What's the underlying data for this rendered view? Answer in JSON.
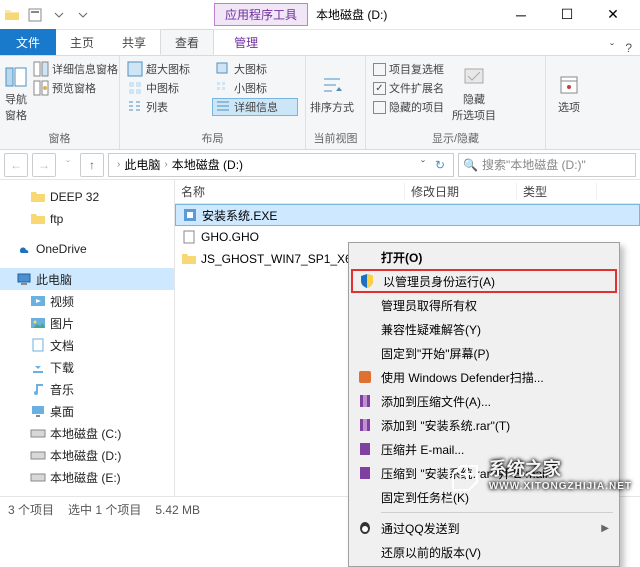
{
  "title": {
    "app_tools": "应用程序工具",
    "location": "本地磁盘 (D:)"
  },
  "tabs": {
    "file": "文件",
    "home": "主页",
    "share": "共享",
    "view": "查看",
    "manage": "管理"
  },
  "ribbon": {
    "pane_group": {
      "nav_pane": "导航窗格",
      "details_pane": "详细信息窗格",
      "preview_pane": "预览窗格",
      "label": "窗格"
    },
    "layout_group": {
      "xl_icons": "超大图标",
      "l_icons": "大图标",
      "m_icons": "中图标",
      "s_icons": "小图标",
      "list": "列表",
      "details": "详细信息",
      "label": "布局"
    },
    "sort_group": {
      "sort": "排序方式",
      "label": "当前视图"
    },
    "show_group": {
      "checkboxes": "项目复选框",
      "ext": "文件扩展名",
      "hidden": "隐藏的项目",
      "hide": "隐藏\n所选项目",
      "label": "显示/隐藏"
    },
    "options": "选项"
  },
  "address": {
    "this_pc": "此电脑",
    "drive": "本地磁盘 (D:)",
    "search_placeholder": "搜索\"本地磁盘 (D:)\""
  },
  "tree": {
    "deep32": "DEEP 32",
    "ftp": "ftp",
    "onedrive": "OneDrive",
    "this_pc": "此电脑",
    "videos": "视频",
    "pictures": "图片",
    "documents": "文档",
    "downloads": "下载",
    "music": "音乐",
    "desktop": "桌面",
    "drive_c": "本地磁盘 (C:)",
    "drive_d": "本地磁盘 (D:)",
    "drive_e": "本地磁盘 (E:)"
  },
  "columns": {
    "name": "名称",
    "date": "修改日期",
    "type": "类型"
  },
  "files": {
    "f0": "安装系统.EXE",
    "f1": "GHO.GHO",
    "f2": "JS_GHOST_WIN7_SP1_X64_"
  },
  "context_menu": {
    "open": "打开(O)",
    "run_as_admin": "以管理员身份运行(A)",
    "take_ownership": "管理员取得所有权",
    "troubleshoot": "兼容性疑难解答(Y)",
    "pin_start": "固定到\"开始\"屏幕(P)",
    "defender": "使用 Windows Defender扫描...",
    "add_archive": "添加到压缩文件(A)...",
    "add_rar": "添加到 \"安装系统.rar\"(T)",
    "compress_email": "压缩并 E-mail...",
    "compress_to_email": "压缩到 \"安装系统.rar\" 并 E-mail",
    "pin_taskbar": "固定到任务栏(K)",
    "qq_send": "通过QQ发送到",
    "restore_prev": "还原以前的版本(V)"
  },
  "status": {
    "items": "3 个项目",
    "selected": "选中 1 个项目",
    "size": "5.42 MB"
  },
  "watermark": {
    "text": "系统之家",
    "url": "WWW.XITONGZHIJIA.NET"
  }
}
